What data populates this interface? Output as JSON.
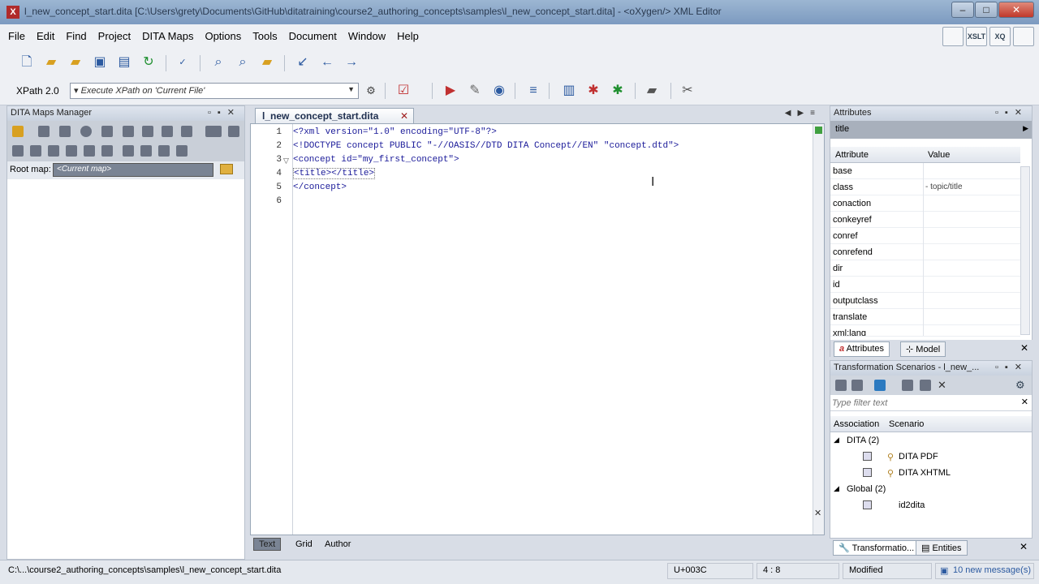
{
  "window": {
    "title": "l_new_concept_start.dita [C:\\Users\\grety\\Documents\\GitHub\\ditatraining\\course2_authoring_concepts\\samples\\l_new_concept_start.dita] - <oXygen/> XML Editor",
    "minimize": "–",
    "maximize": "□",
    "close": "✕"
  },
  "menu": [
    "File",
    "Edit",
    "Find",
    "Project",
    "DITA Maps",
    "Options",
    "Tools",
    "Document",
    "Window",
    "Help"
  ],
  "perspectives": [
    "",
    "XSLT",
    "XQ",
    ""
  ],
  "xpath": {
    "version": "XPath 2.0",
    "placeholder": "▾ Execute XPath on  'Current File'"
  },
  "maps_manager": {
    "title": "DITA Maps Manager",
    "root_map_label": "Root map:",
    "root_map_value": "<Current map>"
  },
  "editor": {
    "tab_label": "l_new_concept_start.dita",
    "lines": [
      "1",
      "2",
      "3",
      "4",
      "5",
      "6"
    ],
    "code": {
      "line1": "<?xml version=\"1.0\" encoding=\"UTF-8\"?>",
      "line2": "<!DOCTYPE concept PUBLIC \"-//OASIS//DTD DITA Concept//EN\" \"concept.dtd\">",
      "line3": "<concept id=\"my_first_concept\">",
      "line4": "<title></title>",
      "line5": "</concept>"
    },
    "modes": [
      "Text",
      "Grid",
      "Author"
    ]
  },
  "attributes": {
    "title": "Attributes",
    "element": "title",
    "col_attribute": "Attribute",
    "col_value": "Value",
    "rows": [
      {
        "name": "base",
        "value": ""
      },
      {
        "name": "class",
        "value": "- topic/title"
      },
      {
        "name": "conaction",
        "value": ""
      },
      {
        "name": "conkeyref",
        "value": ""
      },
      {
        "name": "conref",
        "value": ""
      },
      {
        "name": "conrefend",
        "value": ""
      },
      {
        "name": "dir",
        "value": ""
      },
      {
        "name": "id",
        "value": ""
      },
      {
        "name": "outputclass",
        "value": ""
      },
      {
        "name": "translate",
        "value": ""
      },
      {
        "name": "xml:lang",
        "value": ""
      }
    ],
    "tabs": [
      "Attributes",
      "Model"
    ]
  },
  "transformation": {
    "title": "Transformation Scenarios - l_new_...",
    "filter_placeholder": "Type filter text",
    "col_association": "Association",
    "col_scenario": "Scenario",
    "groups": [
      {
        "label": "DITA (2)",
        "items": [
          "DITA PDF",
          "DITA XHTML"
        ]
      },
      {
        "label": "Global (2)",
        "items": [
          "id2dita"
        ]
      }
    ],
    "tabs": [
      "Transformatio...",
      "Entities"
    ]
  },
  "status": {
    "path": "C:\\...\\course2_authoring_concepts\\samples\\l_new_concept_start.dita",
    "unicode": "U+003C",
    "position": "4 : 8",
    "modified": "Modified",
    "messages": "10 new message(s)"
  }
}
